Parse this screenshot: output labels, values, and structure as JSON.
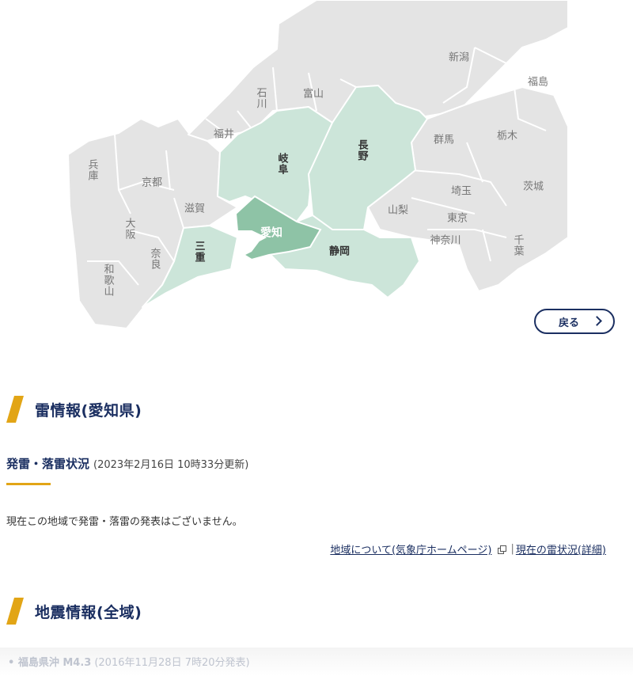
{
  "map": {
    "prefectures": [
      {
        "name": "新潟",
        "state": "other"
      },
      {
        "name": "福島",
        "state": "other"
      },
      {
        "name": "石川",
        "state": "other"
      },
      {
        "name": "富山",
        "state": "other"
      },
      {
        "name": "福井",
        "state": "other"
      },
      {
        "name": "群馬",
        "state": "other"
      },
      {
        "name": "栃木",
        "state": "other"
      },
      {
        "name": "岐阜",
        "state": "neighbor"
      },
      {
        "name": "長野",
        "state": "neighbor"
      },
      {
        "name": "兵庫",
        "state": "other"
      },
      {
        "name": "京都",
        "state": "other"
      },
      {
        "name": "滋賀",
        "state": "other"
      },
      {
        "name": "埼玉",
        "state": "other"
      },
      {
        "name": "茨城",
        "state": "other"
      },
      {
        "name": "山梨",
        "state": "other"
      },
      {
        "name": "東京",
        "state": "other"
      },
      {
        "name": "大阪",
        "state": "other"
      },
      {
        "name": "愛知",
        "state": "selected"
      },
      {
        "name": "三重",
        "state": "neighbor"
      },
      {
        "name": "静岡",
        "state": "neighbor"
      },
      {
        "name": "神奈川",
        "state": "other"
      },
      {
        "name": "千葉",
        "state": "other"
      },
      {
        "name": "奈良",
        "state": "other"
      },
      {
        "name": "和歌山",
        "state": "other"
      }
    ],
    "colors": {
      "land": "#e4e4e4",
      "border": "#ffffff",
      "neighbor": "#cce5d9",
      "selected": "#8ec3a6"
    },
    "back_label": "戻る"
  },
  "thunder": {
    "title": "雷情報(愛知県)",
    "sub_title": "発雷・落雷状況",
    "updated": "(2023年2月16日 10時33分更新)",
    "message": "現在この地域で発雷・落雷の発表はございません。",
    "link_area": "地域について(気象庁ホームページ)",
    "separator": "|",
    "link_current": "現在の雷状況(詳細)"
  },
  "earthquake": {
    "title": "地震情報(全域)",
    "item_name": "• 福島県沖 M4.3",
    "item_date": "(2016年11月28日 7時20分発表)"
  },
  "accent_color": "#e2a516",
  "navy": "#1b2f61"
}
